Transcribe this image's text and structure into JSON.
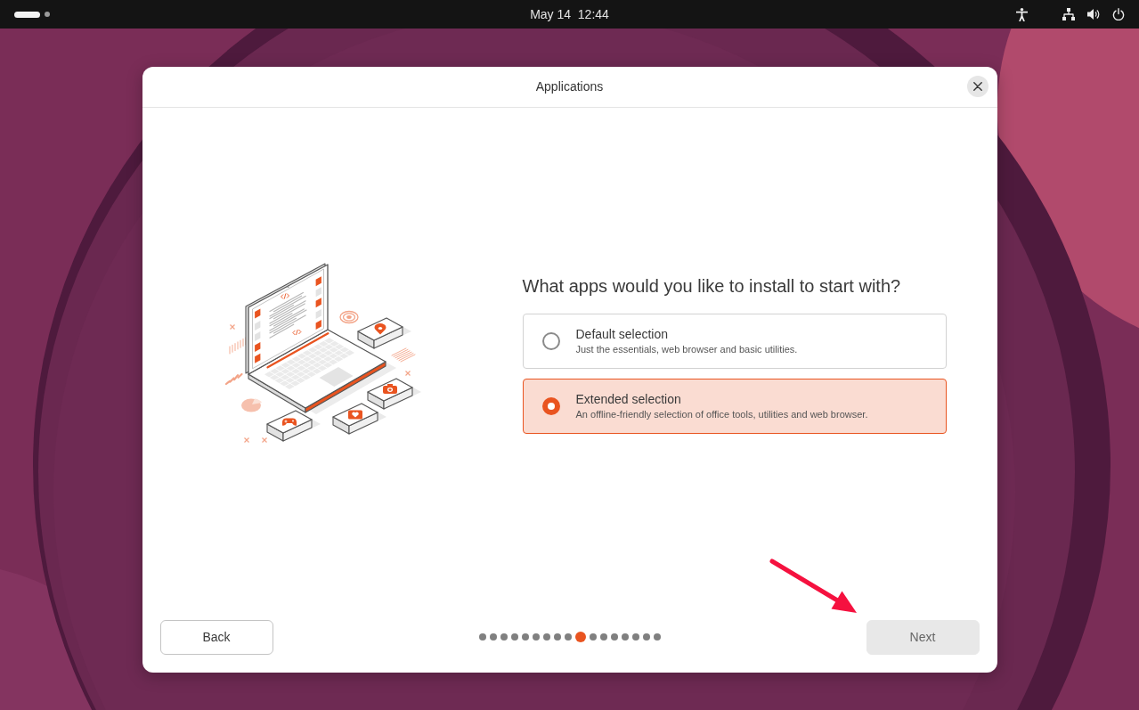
{
  "top_bar": {
    "workspaces": [
      {
        "selected": true
      },
      {
        "selected": false
      }
    ],
    "clock": "May 14  12:44"
  },
  "window": {
    "title": "Applications"
  },
  "question": "What apps would you like to install to start with?",
  "options": [
    {
      "title": "Default selection",
      "description": "Just the essentials, web browser and basic utilities.",
      "selected": false
    },
    {
      "title": "Extended selection",
      "description": "An offline-friendly selection of office tools, utilities and web browser.",
      "selected": true
    }
  ],
  "progress": {
    "steps": [
      {
        "selected": false
      },
      {
        "selected": false
      },
      {
        "selected": false
      },
      {
        "selected": false
      },
      {
        "selected": false
      },
      {
        "selected": false
      },
      {
        "selected": false
      },
      {
        "selected": false
      },
      {
        "selected": false
      },
      {
        "selected": true
      },
      {
        "selected": false
      },
      {
        "selected": false
      },
      {
        "selected": false
      },
      {
        "selected": false
      },
      {
        "selected": false
      },
      {
        "selected": false
      },
      {
        "selected": false
      }
    ]
  },
  "back_button": "Back",
  "next_button": "Next"
}
